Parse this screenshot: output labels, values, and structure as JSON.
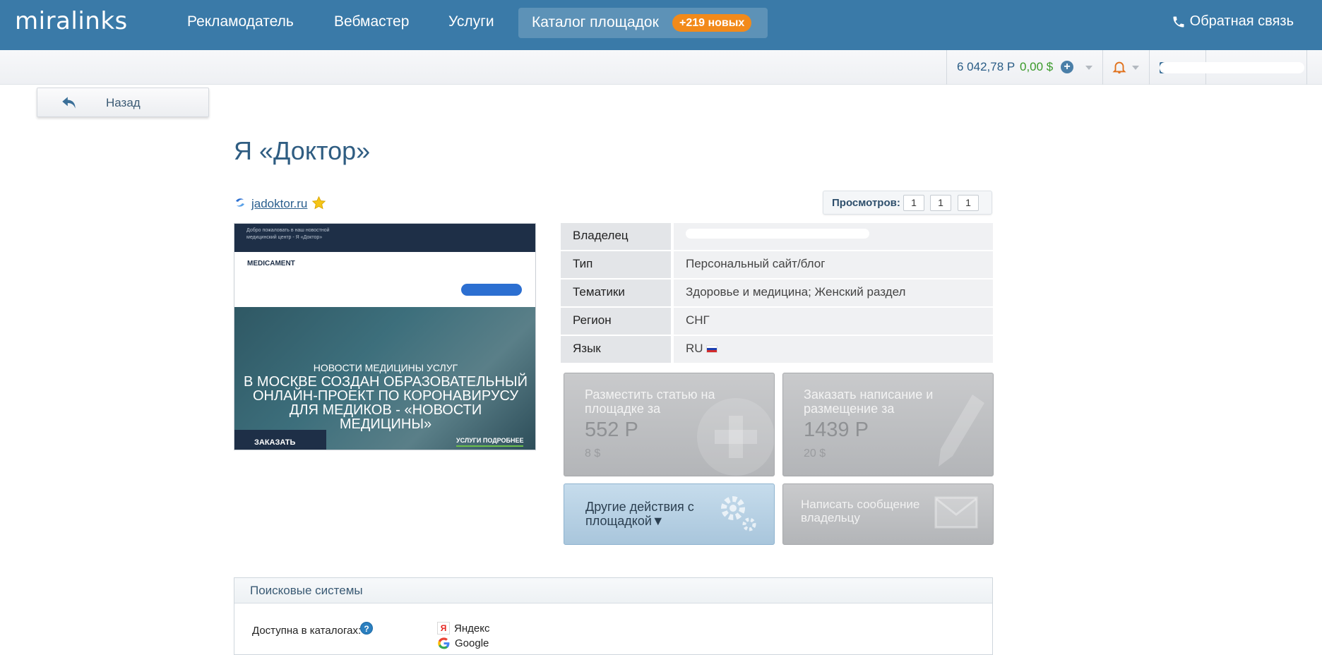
{
  "header": {
    "logo": "miralinks",
    "nav": [
      "Рекламодатель",
      "Вебмастер",
      "Услуги"
    ],
    "catalog_label": "Каталог площадок",
    "catalog_badge": "+219 новых",
    "feedback": "Обратная связь"
  },
  "subbar": {
    "balance_rub": "6 042,78 Р",
    "balance_usd": "0,00 $"
  },
  "back": {
    "label": "Назад"
  },
  "page": {
    "title": "Я «Доктор»",
    "site": "jadoktor.ru"
  },
  "views": {
    "label": "Просмотров:",
    "values": [
      "1",
      "1",
      "1"
    ]
  },
  "screenshot": {
    "top_text": "Добро пожаловать в наш новостной медицинский центр - Я «Доктор»",
    "logo": "MEDICAMENT",
    "hero_small": "НОВОСТИ МЕДИЦИНЫ УСЛУГ",
    "hero_big": "В МОСКВЕ СОЗДАН ОБРАЗОВАТЕЛЬНЫЙ ОНЛАЙН-ПРОЕКТ ПО КОРОНАВИРУСУ ДЛЯ МЕДИКОВ - «НОВОСТИ МЕДИЦИНЫ»",
    "order": "ЗАКАЗАТЬ",
    "more": "УСЛУГИ ПОДРОБНЕЕ"
  },
  "info": [
    {
      "key": "Владелец",
      "value": ""
    },
    {
      "key": "Тип",
      "value": "Персональный сайт/блог"
    },
    {
      "key": "Тематики",
      "value": "Здоровье и медицина; Женский раздел"
    },
    {
      "key": "Регион",
      "value": "СНГ"
    },
    {
      "key": "Язык",
      "value": "RU"
    }
  ],
  "actions": {
    "place": {
      "title": "Разместить статью на площадке за",
      "price": "552 Р",
      "usd": "8 $"
    },
    "order": {
      "title": "Заказать написание и размещение за",
      "price": "1439 Р",
      "usd": "20 $"
    },
    "other": {
      "title": "Другие действия с площадкой▼"
    },
    "message": {
      "title": "Написать сообщение владельцу"
    }
  },
  "search_panel": {
    "title": "Поисковые системы",
    "available_label": "Доступна в каталогах:",
    "engines": [
      "Яндекс",
      "Google"
    ]
  },
  "colors": {
    "header_bg": "#3a7aa8",
    "badge": "#f28a1a",
    "usd_green": "#3a9a2a"
  }
}
